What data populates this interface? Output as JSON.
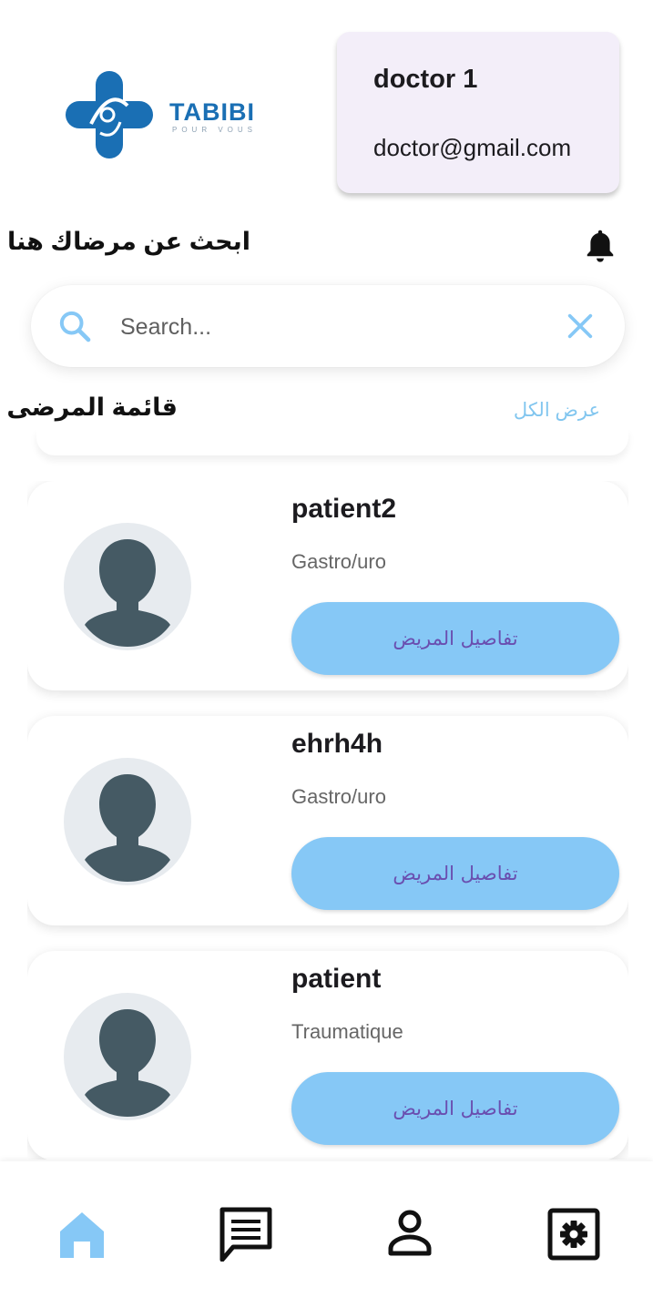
{
  "logo": {
    "brand": "TABIBI",
    "tagline": "POUR VOUS"
  },
  "doctor": {
    "name": "doctor 1",
    "email": "doctor@gmail.com"
  },
  "header": {
    "search_title": "ابحث عن مرضاك هنا"
  },
  "search": {
    "placeholder": "Search..."
  },
  "list": {
    "title": "قائمة المرضى",
    "view_all": "عرض الكل"
  },
  "patients": [
    {
      "name": "patient2",
      "specialty": "Gastro/uro",
      "button": "تفاصيل المريض"
    },
    {
      "name": "ehrh4h",
      "specialty": "Gastro/uro",
      "button": "تفاصيل المريض"
    },
    {
      "name": "patient",
      "specialty": "Traumatique",
      "button": "تفاصيل المريض"
    }
  ],
  "nav": {
    "items": [
      {
        "icon": "home-icon",
        "active": true
      },
      {
        "icon": "chat-icon",
        "active": false
      },
      {
        "icon": "person-icon",
        "active": false
      },
      {
        "icon": "settings-icon",
        "active": false
      }
    ]
  },
  "colors": {
    "accent": "#86c8f6",
    "accent_text": "#82c6ef",
    "button_text": "#6a4fb0",
    "doctor_card": "#f3eef9",
    "logo_blue": "#1a6fb4",
    "avatar_bg": "#e7ebef",
    "avatar_fg": "#455a64"
  }
}
